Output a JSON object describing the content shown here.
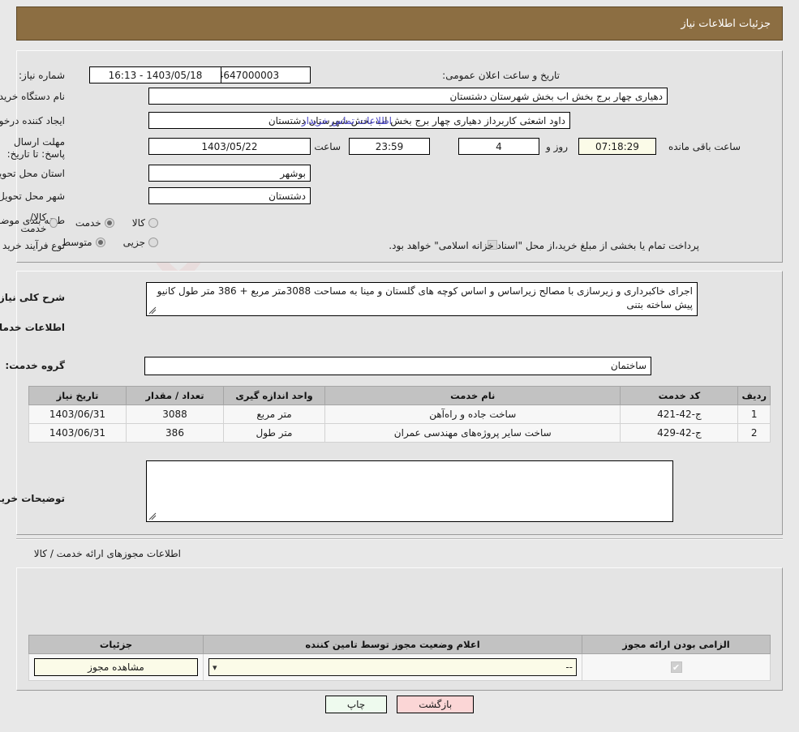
{
  "header": {
    "title": "جزئیات اطلاعات نیاز",
    "bar_color": "#8c6e42"
  },
  "watermark": {
    "text": "AriaTender.net"
  },
  "main_form": {
    "need_number": {
      "label": "شماره نیاز:",
      "value": "1103104647000003"
    },
    "announce_datetime": {
      "label": "تاریخ و ساعت اعلان عمومی:",
      "value": "1403/05/18 - 16:13"
    },
    "buyer_org": {
      "label": "نام دستگاه خریدار:",
      "value": "دهیاری چهار برج بخش اب بخش شهرستان دشتستان"
    },
    "requester": {
      "label": "ایجاد کننده درخواست:",
      "value": "داود اشعثی کاربرداز دهیاری چهار برج بخش اب بخش شهرستان دشتستان"
    },
    "contact_link": "اطلاعات تماس خریدار",
    "deadline": {
      "label": "مهلت ارسال پاسخ: تا تاریخ:",
      "date": "1403/05/22",
      "time_label": "ساعت",
      "time": "23:59",
      "days": "4",
      "days_suffix": "روز و",
      "countdown": "07:18:29",
      "countdown_suffix": "ساعت باقی مانده"
    },
    "province": {
      "label": "استان محل تحویل:",
      "value": "بوشهر"
    },
    "city": {
      "label": "شهر محل تحویل:",
      "value": "دشتستان"
    },
    "classification": {
      "label": "طبقه بندی موضوعی:",
      "options": [
        {
          "label": "کالا",
          "selected": false
        },
        {
          "label": "خدمت",
          "selected": true
        },
        {
          "label": "کالا/خدمت",
          "selected": false
        }
      ]
    },
    "purchase_type": {
      "label": "نوع فرآیند خرید :",
      "options": [
        {
          "label": "جزیی",
          "selected": false
        },
        {
          "label": "متوسط",
          "selected": true
        }
      ],
      "checkbox_note": "پرداخت تمام یا بخشی از مبلغ خرید،از محل \"اسناد خزانه اسلامی\" خواهد بود.",
      "checkbox_checked": false
    }
  },
  "description_section": {
    "overall_label": "شرح کلی نیاز:",
    "overall_value": "اجرای خاکبرداری و زیرسازی با مصالح زیراساس و اساس کوچه های گلستان و مینا به مساحت 3088متر مربع + 386 متر طول کانیو پیش ساخته بتنی",
    "services_caption": "اطلاعات خدمات مورد نیاز",
    "service_group_label": "گروه خدمت:",
    "service_group_value": "ساختمان",
    "table": {
      "columns": [
        "ردیف",
        "کد خدمت",
        "نام خدمت",
        "واحد اندازه گیری",
        "تعداد / مقدار",
        "تاریخ نیاز"
      ],
      "rows": [
        {
          "row": "1",
          "code": "ج-42-421",
          "name": "ساخت جاده و راه‌آهن",
          "unit": "متر مربع",
          "qty": "3088",
          "date": "1403/06/31"
        },
        {
          "row": "2",
          "code": "ج-42-429",
          "name": "ساخت سایر پروژه‌های مهندسی عمران",
          "unit": "متر طول",
          "qty": "386",
          "date": "1403/06/31"
        }
      ]
    },
    "buyer_notes_label": "توضیحات خریدار:",
    "buyer_notes_value": ""
  },
  "license_section": {
    "caption": "اطلاعات مجوزهای ارائه خدمت / کالا",
    "columns": [
      "الزامی بودن ارائه مجوز",
      "اعلام وضعیت مجوز توسط تامین کننده",
      "جزئیات"
    ],
    "rows": [
      {
        "required_checked": true,
        "status_value": "--",
        "details_button": "مشاهده مجوز"
      }
    ]
  },
  "footer": {
    "print_button": "چاپ",
    "back_button": "بازگشت"
  }
}
